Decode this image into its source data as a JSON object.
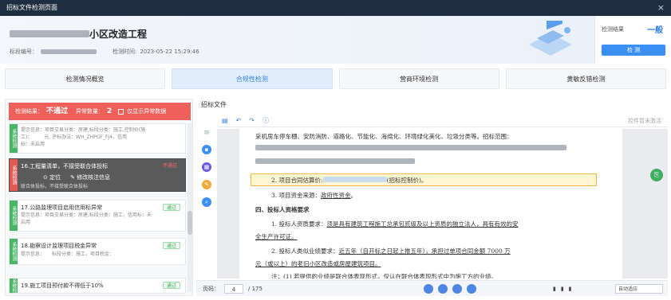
{
  "window": {
    "title": "招标文件检测页面",
    "close": "×"
  },
  "header": {
    "title_suffix": "小区改造工程",
    "section_label": "标段编号：",
    "time_label": "检测时间:",
    "time_value": "2023-05-22 15:29:46",
    "result_label": "检测结果",
    "result_value": "一般",
    "detect_button": "检 测"
  },
  "tabs": [
    {
      "label": "检测情况概览",
      "active": false
    },
    {
      "label": "合规性检测",
      "active": true
    },
    {
      "label": "营商环境检测",
      "active": false
    },
    {
      "label": "黄敏反错检测",
      "active": false
    }
  ],
  "check_summary": {
    "result_label": "检测结果：",
    "result_value": "不通过",
    "exception_label": "异常数量：",
    "exception_count": "2",
    "only_exception": "仅显示异常数据"
  },
  "items": [
    {
      "side": "系统检测",
      "title": "",
      "sub1": "提示信息：项目交易分类：房建,标段分类：施工,控制价(施",
      "sub2": "工)：　　　元, 评标办法：WH_ZHPGF_FJ4，信用",
      "sub3": "标：未启用",
      "badge": ""
    },
    {
      "side": "系统检测",
      "title": "16.工程量清单，不接受联合体投标",
      "sub1": "",
      "sub2": "",
      "sub3": "联合体投标，不接受联合体投标",
      "badge": "不通过",
      "op1": "定位",
      "op2": "修改核注信息"
    },
    {
      "side": "系统检测",
      "title": "17.公路监理项目启用信用标异常",
      "sub1": "提示信息：项目交易分类：房建,标段分类：施工，信用标：未",
      "sub2": "启用",
      "sub3": "",
      "badge": "通过"
    },
    {
      "side": "系统检测",
      "title": "18.勘察设计监理项目税金异常",
      "sub1": "提示信息：　　标段分类：施工，项目税金：",
      "sub2": "",
      "sub3": "",
      "badge": "通过"
    },
    {
      "side": "系统检测",
      "title": "19.施工项目预付款不得低于10%",
      "sub1": "",
      "sub2": "",
      "sub3": "",
      "badge": "通过"
    }
  ],
  "doc": {
    "panel_title": "招标文件",
    "right_hint": "控件暂未激活",
    "line1": "采机房车停车棚、安防消防、道路化、节能化、海绵化、环境绿化美化、垃圾分类等。招标范围：",
    "line4_prefix": "2. 项目合同估算价:",
    "line4_suffix": "(招标控制价)。",
    "line5": "3. 项目资金来源：",
    "line5_link": "政府性资金",
    "line5_end": "。",
    "heading4": "四、投标人资格要求",
    "line7_prefix": "1. 投标人资质要求：",
    "line7_ul": "须是具有建筑工程施工总承包贰级及以上资质的独立法人，具有有效的安",
    "line8_ul": "全生产许可证。",
    "line9_prefix": "2. 投标人类似业绩要求：",
    "line9_ul": "近五年（自开标之日起上推五年），承担过单项合同金额 7000 万",
    "line10_ul": "元（或以上）的老旧小区改造或房屋建筑项目。",
    "line11": "注：(1) 若提供的业绩是联合体表现形式，仅认在联合体表现形式中为施工方的业绩。"
  },
  "pager": {
    "label": "页码：",
    "current": "4",
    "total": "/ 175",
    "zoom": "自动适应"
  },
  "colors": {
    "accent": "#2d7fe0",
    "fail": "#f0605a",
    "pass": "#48b466",
    "titlebar": "#1f2d40"
  }
}
